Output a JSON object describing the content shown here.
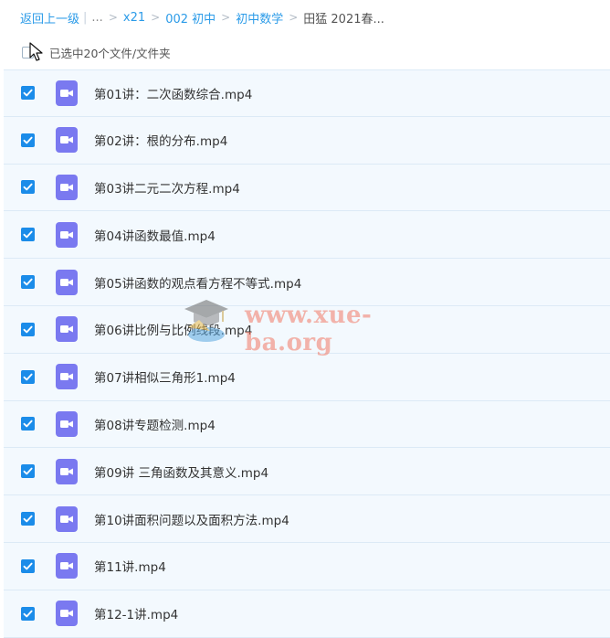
{
  "breadcrumb": {
    "back_label": "返回上一级",
    "ellipsis": "...",
    "crumbs": [
      "x21",
      "002 初中",
      "初中数学"
    ],
    "current": "田猛 2021春..."
  },
  "selection": {
    "label": "已选中20个文件/文件夹"
  },
  "files": [
    {
      "name": "第01讲：二次函数综合.mp4"
    },
    {
      "name": "第02讲：根的分布.mp4"
    },
    {
      "name": "第03讲二元二次方程.mp4"
    },
    {
      "name": "第04讲函数最值.mp4"
    },
    {
      "name": "第05讲函数的观点看方程不等式.mp4"
    },
    {
      "name": "第06讲比例与比例线段.mp4"
    },
    {
      "name": "第07讲相似三角形1.mp4"
    },
    {
      "name": "第08讲专题检测.mp4"
    },
    {
      "name": "第09讲 三角函数及其意义.mp4"
    },
    {
      "name": "第10讲面积问题以及面积方法.mp4"
    },
    {
      "name": "第11讲.mp4"
    },
    {
      "name": "第12-1讲.mp4"
    }
  ],
  "watermark": {
    "text": "www.xue-ba.org"
  },
  "colors": {
    "accent": "#1b8ce9",
    "link": "#2b9be8",
    "video_icon": "#7a79f0",
    "row_bg": "#f3f9fe"
  },
  "icons": {
    "checkbox": "checkmark-icon",
    "file": "video-file-icon",
    "cursor": "mouse-pointer-icon",
    "watermark_logo": "graduation-cap-icon"
  }
}
